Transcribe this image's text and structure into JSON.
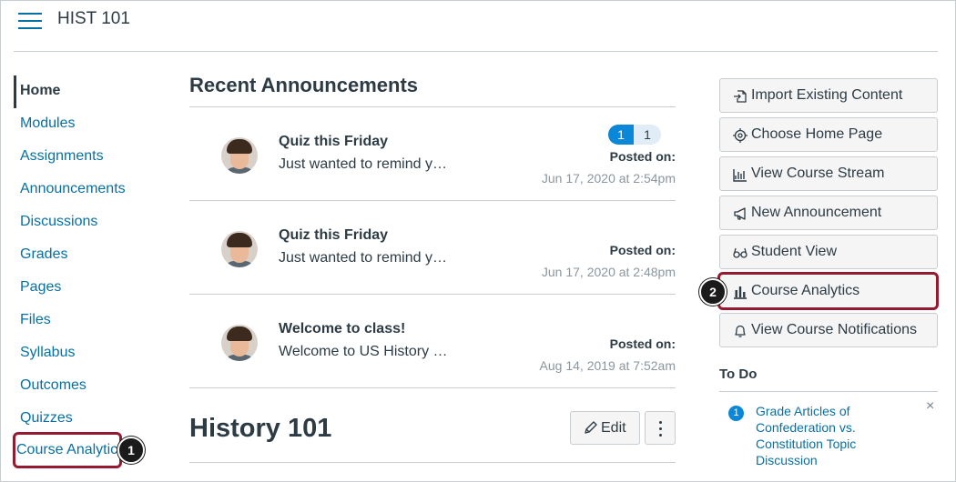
{
  "header": {
    "course_title": "HIST 101"
  },
  "nav": {
    "items": [
      "Home",
      "Modules",
      "Assignments",
      "Announcements",
      "Discussions",
      "Grades",
      "Pages",
      "Files",
      "Syllabus",
      "Outcomes",
      "Quizzes"
    ],
    "course_analytics": "Course Analytic",
    "active": "Home"
  },
  "callouts": {
    "first": "1",
    "second": "2"
  },
  "announcements": {
    "title": "Recent Announcements",
    "badge_new": "1",
    "badge_total": "1",
    "items": [
      {
        "title": "Quiz this Friday",
        "snippet": "Just wanted to remind y…",
        "posted_label": "Posted on:",
        "date": "Jun 17, 2020 at 2:54pm"
      },
      {
        "title": "Quiz this Friday",
        "snippet": "Just wanted to remind y…",
        "posted_label": "Posted on:",
        "date": "Jun 17, 2020 at 2:48pm"
      },
      {
        "title": "Welcome to class!",
        "snippet": "Welcome to US History …",
        "posted_label": "Posted on:",
        "date": "Aug 14, 2019 at 7:52am"
      }
    ]
  },
  "course": {
    "heading": "History 101",
    "edit_label": "Edit"
  },
  "sidebar": {
    "buttons": [
      {
        "label": "Import Existing Content",
        "icon": "import-icon"
      },
      {
        "label": "Choose Home Page",
        "icon": "target-icon"
      },
      {
        "label": "View Course Stream",
        "icon": "stream-icon"
      },
      {
        "label": "New Announcement",
        "icon": "megaphone-icon"
      },
      {
        "label": "Student View",
        "icon": "glasses-icon"
      },
      {
        "label": "Course Analytics",
        "icon": "bar-chart-icon"
      },
      {
        "label": "View Course Notifications",
        "icon": "bell-icon"
      }
    ]
  },
  "todo": {
    "title": "To Do",
    "count": "1",
    "item": "Grade Articles of Confederation vs. Constitution Topic Discussion",
    "close": "×"
  },
  "colors": {
    "link": "#0770a3",
    "accent_badge": "#0b87d8",
    "highlight": "#951a2f",
    "text": "#2d3b45"
  }
}
